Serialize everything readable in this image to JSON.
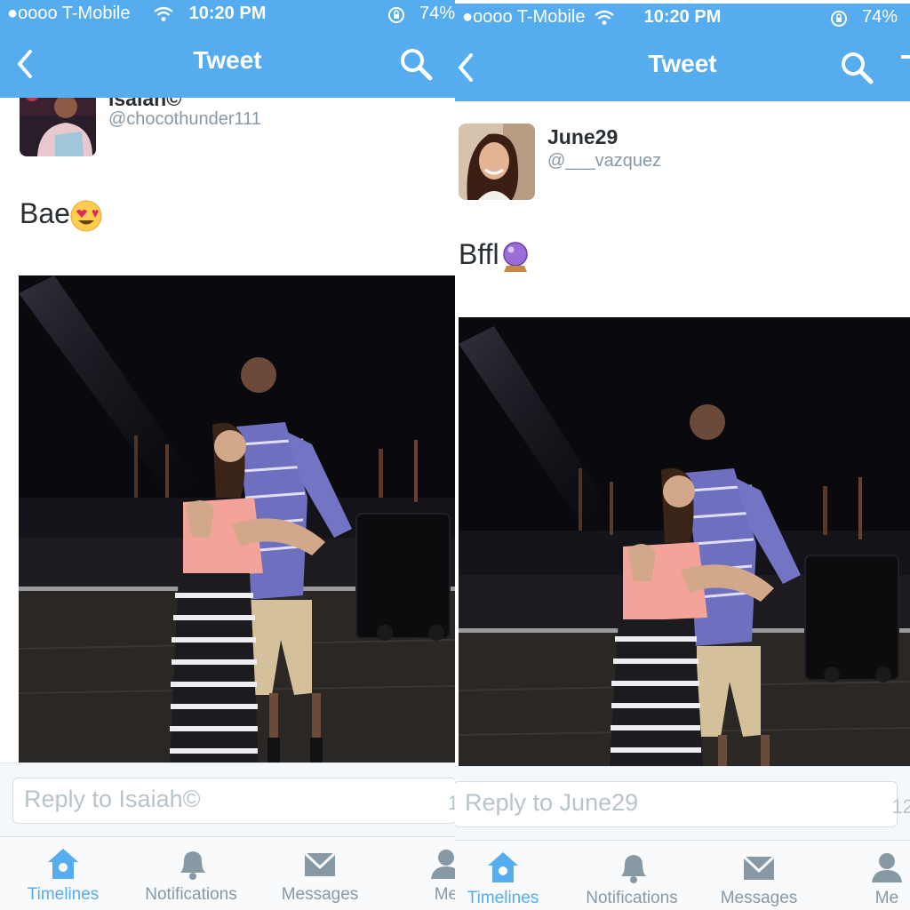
{
  "status_bar": {
    "left_carrier": "●oooo T-Mobile",
    "right_carrier": "●oooo T-Mobile",
    "time": "10:20 PM",
    "left_battery": "74%",
    "right_battery": "74%"
  },
  "navbar": {
    "title": "Tweet"
  },
  "left_tweet": {
    "name": "Isaiah©",
    "handle": "@chocothunder111",
    "text": "Bae",
    "emoji": "heart-eyes-emoji",
    "reply_placeholder": "Reply to Isaiah©",
    "counter": "1"
  },
  "right_tweet": {
    "name": "June29",
    "handle": "@___vazquez",
    "text": "Bffl",
    "emoji": "crystal-ball-emoji",
    "reply_placeholder": "Reply to June29",
    "counter": "12"
  },
  "tabs": [
    {
      "label": "Timelines",
      "icon": "home-icon",
      "active": true
    },
    {
      "label": "Notifications",
      "icon": "bell-icon",
      "active": false
    },
    {
      "label": "Messages",
      "icon": "envelope-icon",
      "active": false
    },
    {
      "label": "Me",
      "icon": "person-icon",
      "active": false
    }
  ],
  "colors": {
    "accent": "#55acee",
    "tab_inactive": "#8899a6",
    "text": "#292f33",
    "handle": "#8899a6"
  }
}
